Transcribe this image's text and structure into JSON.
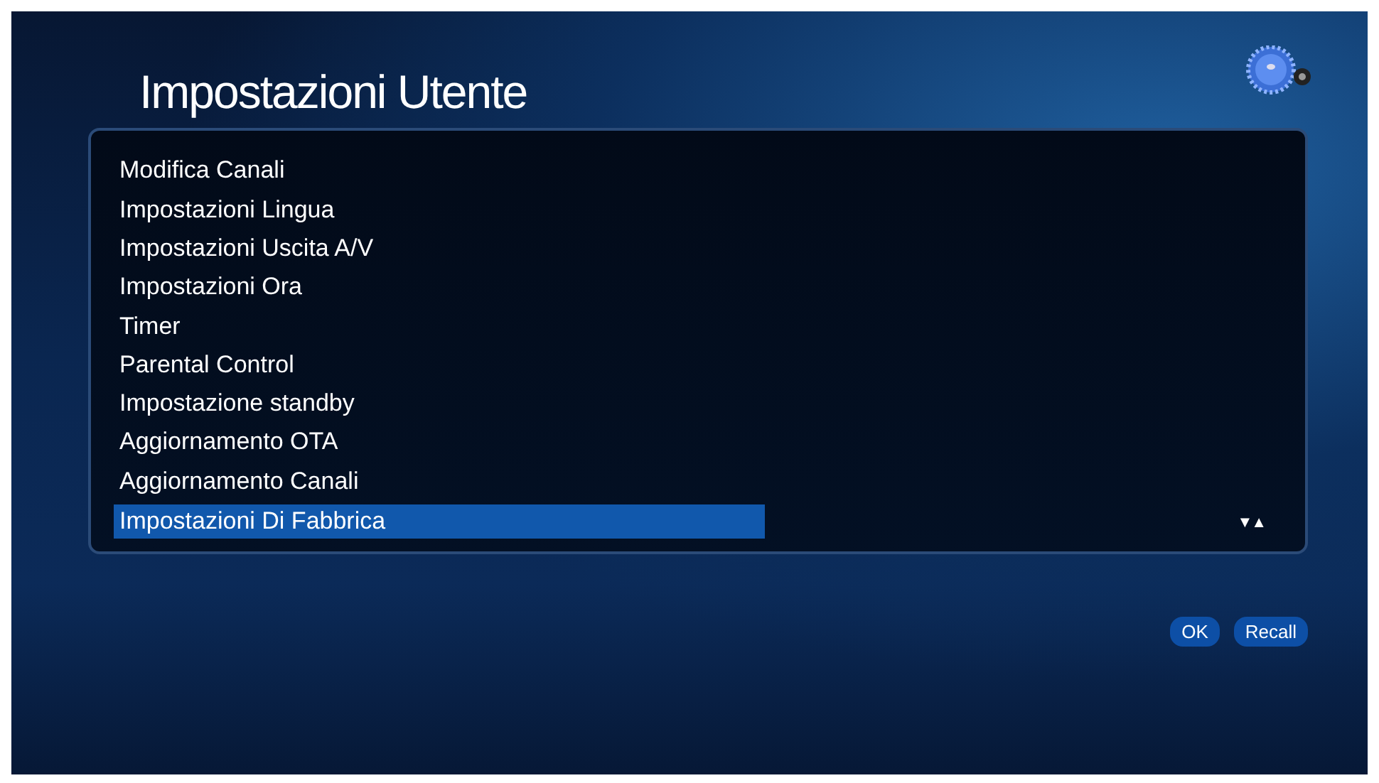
{
  "title": "Impostazioni Utente",
  "menu": [
    {
      "label": "Modifica Canali",
      "selected": false
    },
    {
      "label": "Impostazioni Lingua",
      "selected": false
    },
    {
      "label": "Impostazioni Uscita A/V",
      "selected": false
    },
    {
      "label": "Impostazioni Ora",
      "selected": false
    },
    {
      "label": "Timer",
      "selected": false
    },
    {
      "label": "Parental Control",
      "selected": false
    },
    {
      "label": "Impostazione standby",
      "selected": false
    },
    {
      "label": "Aggiornamento OTA",
      "selected": false
    },
    {
      "label": "Aggiornamento Canali",
      "selected": false
    },
    {
      "label": "Impostazioni Di Fabbrica",
      "selected": true
    }
  ],
  "scroll_indicator": "▼▲",
  "buttons": [
    "OK",
    "Recall"
  ]
}
